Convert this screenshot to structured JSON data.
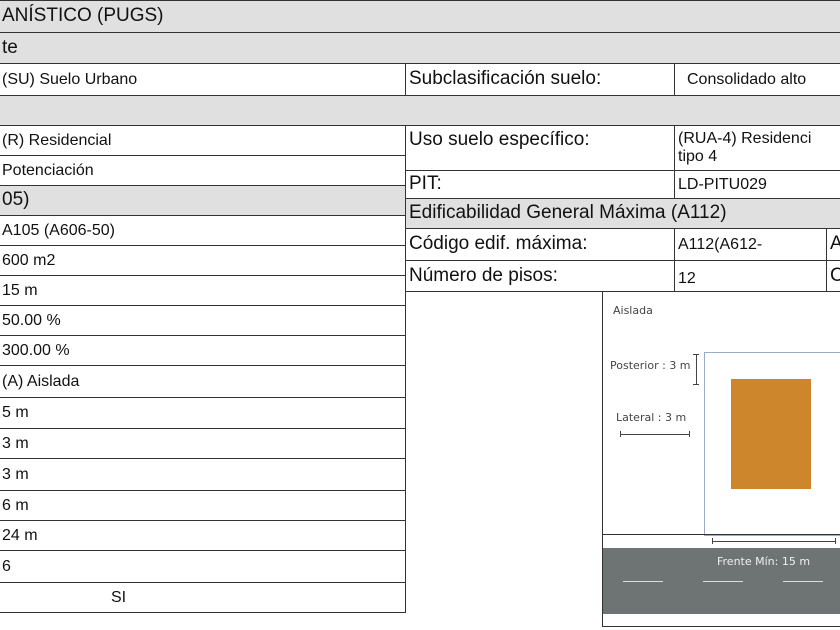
{
  "section_title": "ANÍSTICO (PUGS)",
  "subsection": "te",
  "clasificacion": "(SU) Suelo Urbano",
  "subclasificacion_label": "Subclasificación suelo:",
  "subclasificacion_value": "Consolidado alto",
  "uso_general": "(R) Residencial",
  "tratamiento": "Potenciación",
  "forma_header": "05)",
  "uso_especifico_label": "Uso suelo específico:",
  "uso_especifico_value_1": "(RUA-4) Residenci",
  "uso_especifico_value_2": "tipo 4",
  "pit_label": "PIT:",
  "pit_value": "LD-PITU029",
  "edificabilidad_header": "Edificabilidad General Máxima (A112)",
  "codigo_label": "Código edif. máxima:",
  "codigo_value": "A112(A612-",
  "codigo_extra": "A",
  "pisos_label": "Número de pisos:",
  "pisos_value": "12",
  "pisos_extra": "C",
  "left_values": [
    "A105 (A606-50)",
    "600 m2",
    "15 m",
    "50.00 %",
    "300.00 %",
    "(A) Aislada",
    "5 m",
    "3 m",
    "3 m",
    "6 m",
    "24 m",
    "6"
  ],
  "si": "SI",
  "diagram": {
    "title": "Aislada",
    "posterior": "Posterior : 3 m",
    "lateral": "Lateral : 3 m",
    "frente": "Frente Mín: 15 m",
    "building_color": "#cd862b",
    "road_color": "#6e7473"
  }
}
